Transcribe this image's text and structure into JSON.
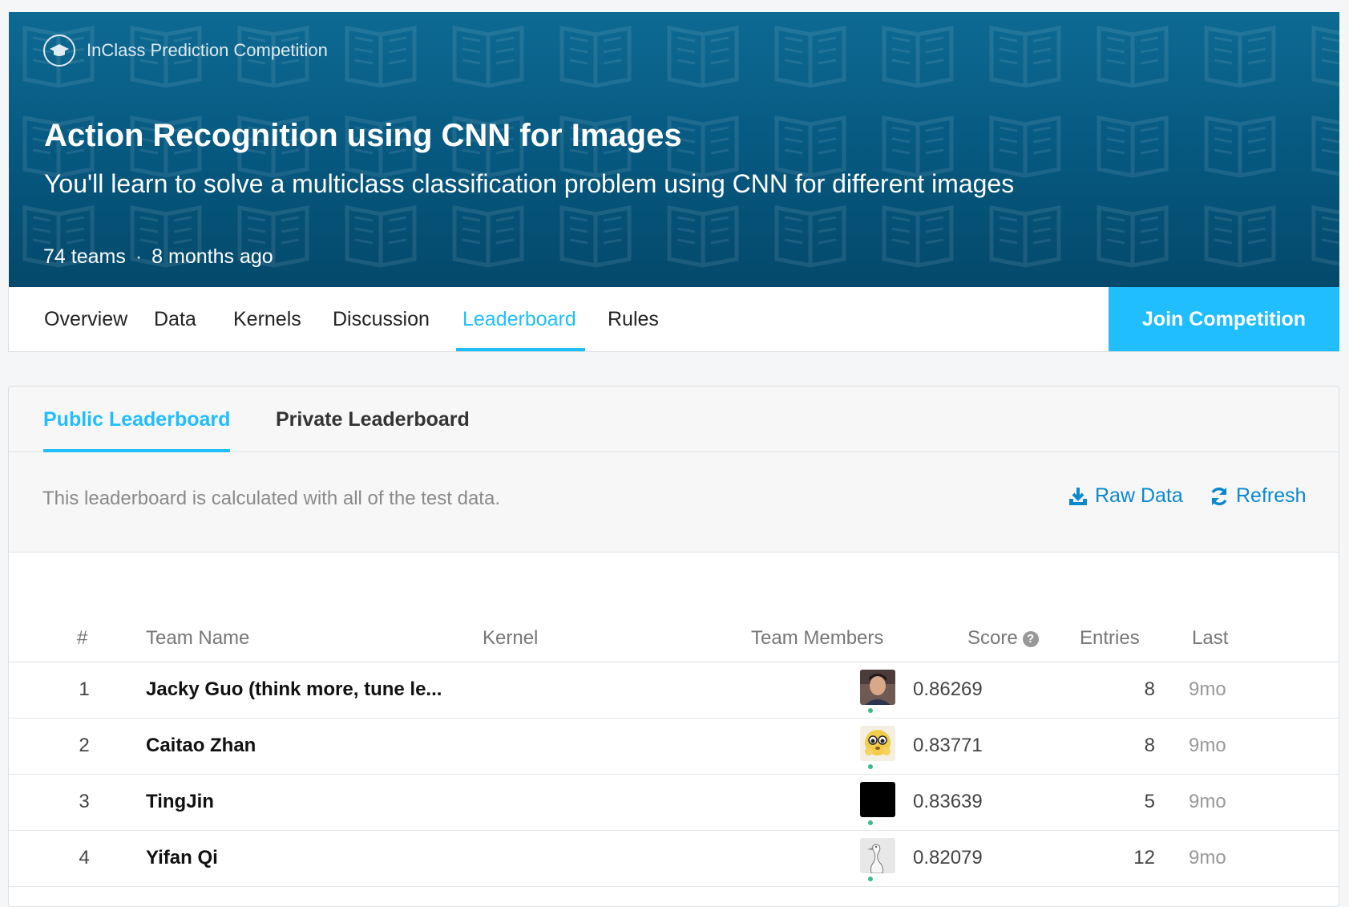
{
  "banner": {
    "competition_type": "InClass Prediction Competition",
    "title": "Action Recognition using CNN for Images",
    "subtitle": "You'll learn to solve a multiclass classification problem using CNN for different images",
    "teams": "74 teams",
    "separator": "·",
    "time_ago": "8 months ago"
  },
  "nav": {
    "tabs": [
      {
        "label": "Overview"
      },
      {
        "label": "Data"
      },
      {
        "label": "Kernels"
      },
      {
        "label": "Discussion"
      },
      {
        "label": "Leaderboard"
      },
      {
        "label": "Rules"
      }
    ],
    "active_tab": "Leaderboard",
    "join_button": "Join Competition"
  },
  "leaderboard": {
    "tabs": [
      {
        "label": "Public Leaderboard"
      },
      {
        "label": "Private Leaderboard"
      }
    ],
    "active_tab": "Public Leaderboard",
    "info_text": "This leaderboard is calculated with all of the test data.",
    "raw_data_label": "Raw Data",
    "refresh_label": "Refresh",
    "columns": {
      "rank": "#",
      "team_name": "Team Name",
      "kernel": "Kernel",
      "team_members": "Team Members",
      "score": "Score",
      "entries": "Entries",
      "last": "Last"
    },
    "rows": [
      {
        "rank": "1",
        "team": "Jacky Guo (think more, tune le...",
        "score": "0.86269",
        "entries": "8",
        "last": "9mo",
        "avatar": "photo"
      },
      {
        "rank": "2",
        "team": "Caitao Zhan",
        "score": "0.83771",
        "entries": "8",
        "last": "9mo",
        "avatar": "emoji"
      },
      {
        "rank": "3",
        "team": "TingJin",
        "score": "0.83639",
        "entries": "5",
        "last": "9mo",
        "avatar": "black"
      },
      {
        "rank": "4",
        "team": "Yifan Qi",
        "score": "0.82079",
        "entries": "12",
        "last": "9mo",
        "avatar": "bird"
      }
    ]
  },
  "colors": {
    "accent": "#20beff",
    "banner": "#06577e",
    "link": "#0b88cc",
    "online": "#3dbb8a"
  }
}
